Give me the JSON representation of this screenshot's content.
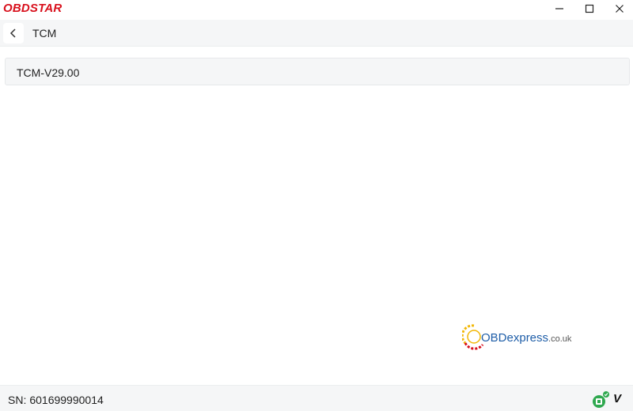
{
  "app": {
    "logo_text": "OBDSTAR",
    "brand_color": "#d8101c"
  },
  "window_controls": {
    "minimize_icon": "minimize-icon",
    "maximize_icon": "maximize-icon",
    "close_icon": "close-icon"
  },
  "navbar": {
    "back_icon": "chevron-left-icon",
    "title": "TCM"
  },
  "list": {
    "items": [
      {
        "label": "TCM-V29.00"
      }
    ]
  },
  "watermark": {
    "text": "OBDexpress",
    "suffix": ".co.uk",
    "color": "#1f5ea8"
  },
  "statusbar": {
    "sn_label": "SN:",
    "sn_value": "601699990014",
    "vci_label": "V",
    "vci_connected_color": "#2fa84f"
  }
}
